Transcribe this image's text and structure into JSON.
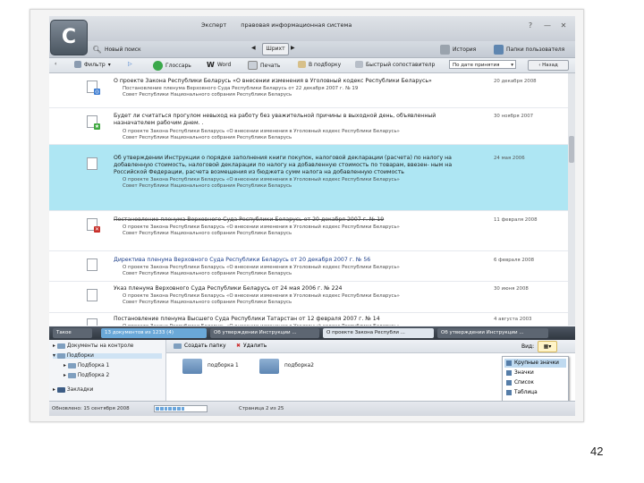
{
  "app": {
    "name": "Эксперт",
    "subtitle": "правовая информационная система",
    "logo_letter": "С",
    "win_controls": [
      "?",
      "—",
      "✕"
    ]
  },
  "toolbar1": {
    "new_search": "Новый поиск",
    "print_label": "Шрихт",
    "history": "История",
    "user_folders": "Папки пользователя"
  },
  "toolbar2": {
    "filter": "Фильтр",
    "glossary": "Глоссарь",
    "word": "Word",
    "print": "Печать",
    "bookmark": "В подборку",
    "calculator": "Быстрый сопоставителр",
    "sort_value": "По дате принятия",
    "back": "Назад"
  },
  "documents": [
    {
      "title": "О проекте Закона Республики Беларусь «О внесении изменения в Уголовный кодекс Республики Беларусь»",
      "meta": [
        "Постановление пленума Верховного Суда Республики Беларусь от 22 декабря 2007 г. № 19",
        "Совет Республики Национального собрания Республики Беларусь"
      ],
      "date": "20 декабря 2008",
      "icon_mark": "◎",
      "mark_color": "#3b7bd1",
      "style": "normal",
      "highlight": false
    },
    {
      "title": "Будет ли считаться прогулом невыход на работу без уважительной причины в выходной день, объявленный назначателем рабочим днем. .",
      "meta": [
        "О проекте Закона Республики Беларусь «О внесении изменения в Уголовный кодекс Республики Беларусь»",
        "Совет Республики Национального собрания Республики Беларусь"
      ],
      "date": "30 ноября 2007",
      "icon_mark": "★",
      "mark_color": "#3fa83f",
      "style": "normal",
      "highlight": false
    },
    {
      "title": "Об утверждении Инструкции о порядке заполнения книги покупок, налоговой декларации (расчета) по налогу на добавленную стоимость, налоговой декларации по налогу на добавленную стоимость по товарам, ввезен- ным на Российской Федерации, расчета возмещения из бюджета сумм налога на добавленную стоимость",
      "meta": [
        "О проекте Закона Республики Беларусь «О внесении изменения в Уголовный кодекс Республики Беларусь»",
        "Совет Республики Национального собрания Республики Беларусь"
      ],
      "date": "24 мая 2006",
      "icon_mark": "",
      "mark_color": "",
      "style": "normal",
      "highlight": true
    },
    {
      "title": "Постановление пленума Верховного Суда Республики Беларусь от 20 декабря 2007 г. № 19",
      "meta": [
        "О проекте Закона Республики Беларусь «О внесении изменения в Уголовный кодекс Республики Беларусь»",
        "Совет Республики Национального собрания Республики Беларусь"
      ],
      "date": "11 февраля 2008",
      "icon_mark": "✕",
      "mark_color": "#c8302a",
      "style": "strike",
      "highlight": false
    },
    {
      "title": "Директива пленума Верховного Суда Республики Беларусь от 20 декабря 2007 г. № 56",
      "meta": [
        "О проекте Закона Республики Беларусь «О внесении изменения в Уголовный кодекс Республики Беларусь»",
        "Совет Республики Национального собрания Республики Беларусь"
      ],
      "date": "6 февраля 2008",
      "icon_mark": "",
      "mark_color": "",
      "style": "blue",
      "highlight": false
    },
    {
      "title": "Указ пленума Верховного Суда Республики Беларусь от 24 мая 2006 г. № 224",
      "meta": [
        "О проекте Закона Республики Беларусь «О внесении изменения в Уголовный кодекс Республики Беларусь»",
        "Совет Республики Национального собрания Республики Беларусь"
      ],
      "date": "30 июня 2008",
      "icon_mark": "",
      "mark_color": "",
      "style": "normal",
      "highlight": false
    },
    {
      "title": "Постановление пленума Высшего Суда Республики Татарстан от 12 февраля 2007 г. № 14",
      "meta": [
        "О проекте Закона Республики Беларусь «О внесении изменения в Уголовный кодекс Республики Беларусь»",
        "Совет Республики Национального собрания Республики Беларусь"
      ],
      "date": "4 августа 2003",
      "icon_mark": "",
      "mark_color": "",
      "style": "normal",
      "highlight": false
    }
  ],
  "tabs": [
    {
      "label": "Такое",
      "style": "plain"
    },
    {
      "label": "13 документов из 1233 (4)",
      "style": "active"
    },
    {
      "label": "Об утверждении Инструкции ...",
      "style": "plain"
    },
    {
      "label": "О проекте Закона Республи ...",
      "style": "light"
    },
    {
      "label": "Об утверждении Инструкции ...",
      "style": "plain"
    }
  ],
  "tree": {
    "items": [
      "Документы на контроле",
      "Подборки",
      "Подборка 1",
      "Подборка 2",
      "Закладки"
    ]
  },
  "panel": {
    "create_folder": "Создать папку",
    "delete": "Удалить",
    "view_label": "Вид:",
    "folders": [
      "подборка 1",
      "подборка2"
    ]
  },
  "view_menu": [
    "Крупные значки",
    "Значки",
    "Список",
    "Таблица"
  ],
  "status": {
    "updated": "Обновлено: 15 сентября 2008",
    "progress_filled_fraction": 0.55,
    "page": "Страница 2 из 25"
  },
  "slide_number": "42"
}
